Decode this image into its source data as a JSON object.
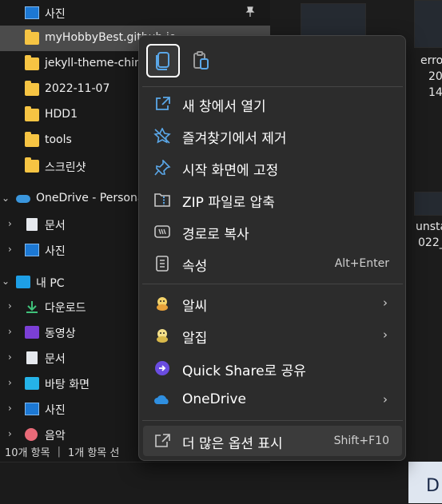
{
  "nav": {
    "items": [
      {
        "label": "사진",
        "icon": "pictures-icon",
        "pinned": true
      },
      {
        "label": "myHobbyBest.github.io",
        "icon": "folder-icon",
        "selected": true
      },
      {
        "label": "jekyll-theme-chirpy",
        "icon": "folder-icon"
      },
      {
        "label": "2022-11-07",
        "icon": "folder-icon"
      },
      {
        "label": "HDD1",
        "icon": "folder-icon"
      },
      {
        "label": "tools",
        "icon": "folder-icon"
      },
      {
        "label": "스크린샷",
        "icon": "folder-icon"
      },
      {
        "label": "OneDrive - Personal",
        "icon": "onedrive-icon"
      },
      {
        "label": "문서",
        "icon": "documents-icon"
      },
      {
        "label": "사진",
        "icon": "pictures-icon"
      },
      {
        "label": "내 PC",
        "icon": "this-pc-icon"
      },
      {
        "label": "다운로드",
        "icon": "downloads-icon"
      },
      {
        "label": "동영상",
        "icon": "videos-icon"
      },
      {
        "label": "문서",
        "icon": "documents-icon"
      },
      {
        "label": "바탕 화면",
        "icon": "desktop-icon"
      },
      {
        "label": "사진",
        "icon": "pictures-icon"
      },
      {
        "label": "음악",
        "icon": "music-icon"
      }
    ]
  },
  "status": {
    "count": "10개 항목",
    "selected": "1개 항목 선"
  },
  "content": {
    "files": [
      {
        "name_line1": "erro",
        "name_line2": "20",
        "name_line3": "14"
      },
      {
        "name_line1": "unsta",
        "name_line2": "022_"
      }
    ],
    "corner_text": "D"
  },
  "menu": {
    "quick_actions": [
      {
        "name": "copy",
        "icon": "copy-icon"
      },
      {
        "name": "paste",
        "icon": "paste-icon"
      }
    ],
    "items": [
      {
        "label": "새 창에서 열기",
        "icon": "open-new-window-icon"
      },
      {
        "label": "즐겨찾기에서 제거",
        "icon": "unpin-star-icon"
      },
      {
        "label": "시작 화면에 고정",
        "icon": "pin-icon"
      },
      {
        "label": "ZIP 파일로 압축",
        "icon": "zip-icon"
      },
      {
        "label": "경로로 복사",
        "icon": "copy-path-icon"
      },
      {
        "label": "속성",
        "icon": "properties-icon",
        "accelerator": "Alt+Enter"
      },
      {
        "label": "알씨",
        "icon": "alsee-icon",
        "submenu": true
      },
      {
        "label": "알집",
        "icon": "alzip-icon",
        "submenu": true
      },
      {
        "label": "Quick Share로 공유",
        "icon": "quick-share-icon"
      },
      {
        "label": "OneDrive",
        "icon": "onedrive-icon",
        "submenu": true
      },
      {
        "label": "더 많은 옵션 표시",
        "icon": "show-more-options-icon",
        "accelerator": "Shift+F10"
      }
    ]
  },
  "colors": {
    "background": "#191919",
    "menu_background": "#2c2c2c",
    "selection": "#4b4b4b",
    "accent": "#5aa7e8",
    "folder": "#f6c443"
  }
}
